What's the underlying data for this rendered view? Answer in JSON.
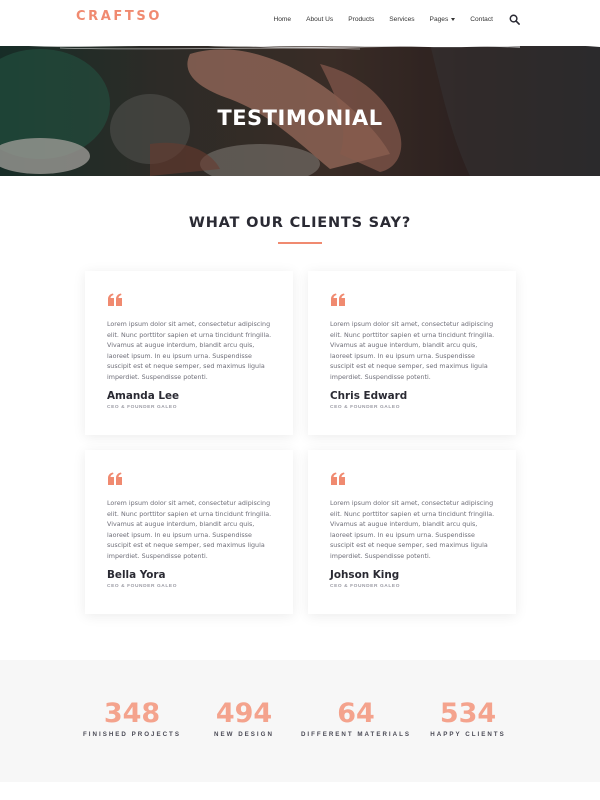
{
  "header": {
    "logo": "CRAFTSO",
    "nav": [
      "Home",
      "About Us",
      "Products",
      "Services",
      "Pages",
      "Contact"
    ],
    "search_icon": "search-icon"
  },
  "hero": {
    "title": "TESTIMONIAL"
  },
  "section": {
    "title": "WHAT OUR CLIENTS SAY?"
  },
  "testimonials": [
    {
      "text": "Lorem ipsum dolor sit amet, consectetur adipiscing elit. Nunc porttitor sapien et urna tincidunt fringilla. Vivamus at augue interdum, blandit arcu quis, laoreet ipsum. In eu ipsum urna. Suspendisse suscipit est et neque semper, sed maximus ligula imperdiet. Suspendisse potenti.",
      "name": "Amanda Lee",
      "role": "CEO & FOUNDER GALEO"
    },
    {
      "text": "Lorem ipsum dolor sit amet, consectetur adipiscing elit. Nunc porttitor sapien et urna tincidunt fringilla. Vivamus at augue interdum, blandit arcu quis, laoreet ipsum. In eu ipsum urna. Suspendisse suscipit est et neque semper, sed maximus ligula imperdiet. Suspendisse potenti.",
      "name": "Chris Edward",
      "role": "CEO & FOUNDER GALEO"
    },
    {
      "text": "Lorem ipsum dolor sit amet, consectetur adipiscing elit. Nunc porttitor sapien et urna tincidunt fringilla. Vivamus at augue interdum, blandit arcu quis, laoreet ipsum. In eu ipsum urna. Suspendisse suscipit est et neque semper, sed maximus ligula imperdiet. Suspendisse potenti.",
      "name": "Bella Yora",
      "role": "CEO & FOUNDER GALEO"
    },
    {
      "text": "Lorem ipsum dolor sit amet, consectetur adipiscing elit. Nunc porttitor sapien et urna tincidunt fringilla. Vivamus at augue interdum, blandit arcu quis, laoreet ipsum. In eu ipsum urna. Suspendisse suscipit est et neque semper, sed maximus ligula imperdiet. Suspendisse potenti.",
      "name": "Johson King",
      "role": "CEO & FOUNDER GALEO"
    }
  ],
  "stats": [
    {
      "value": "348",
      "label": "FINISHED PROJECTS"
    },
    {
      "value": "494",
      "label": "NEW DESIGN"
    },
    {
      "value": "64",
      "label": "DIFFERENT MATERIALS"
    },
    {
      "value": "534",
      "label": "HAPPY CLIENTS"
    }
  ],
  "colors": {
    "accent": "#f08a70",
    "stat_number": "#f4a38d",
    "dark": "#2a2a33",
    "stats_bg": "#f7f7f7"
  }
}
